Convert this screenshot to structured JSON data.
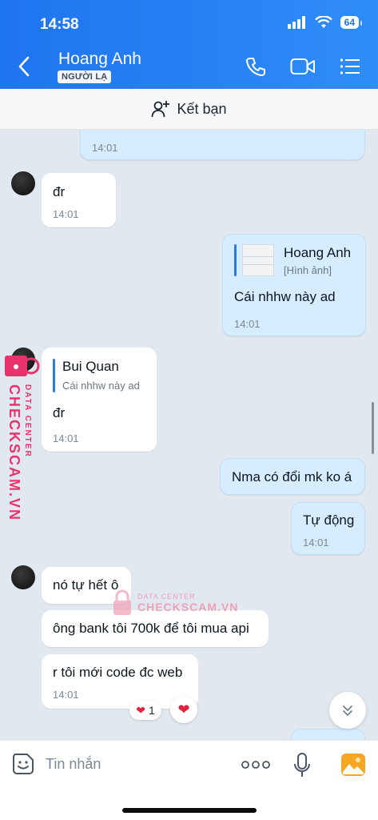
{
  "status": {
    "time": "14:58",
    "battery": "64"
  },
  "header": {
    "title": "Hoang Anh",
    "badge": "NGƯỜI LẠ"
  },
  "add_friend": {
    "label": "Kết bạn"
  },
  "messages": {
    "m0": {
      "time": "14:01"
    },
    "m1": {
      "text": "đr",
      "time": "14:01"
    },
    "m2": {
      "quote_name": "Hoang Anh",
      "quote_sub": "[Hình ảnh]",
      "text": "Cái nhhw này ad",
      "time": "14:01"
    },
    "m3": {
      "quote_name": "Bui Quan",
      "quote_sub": "Cái nhhw này ad",
      "text": "đr",
      "time": "14:01"
    },
    "m4": {
      "text": "Nma có đổi mk ko á"
    },
    "m5": {
      "text": "Tự động",
      "time": "14:01"
    },
    "m6": {
      "text": "nó tự hết ô"
    },
    "m7": {
      "text": "ông bank tôi 700k để tôi mua api"
    },
    "m8": {
      "text": "r tôi mới code đc web",
      "time": "14:01"
    }
  },
  "reaction": {
    "count": "1"
  },
  "input": {
    "placeholder": "Tin nhắn"
  },
  "watermark": {
    "line1": "DATA CENTER",
    "line2": "CHECKSCAM.VN"
  },
  "colors": {
    "header": "#1f74ef",
    "outgoing": "#d6ecff",
    "accent": "#2a7de1",
    "watermark": "#e8336c"
  }
}
